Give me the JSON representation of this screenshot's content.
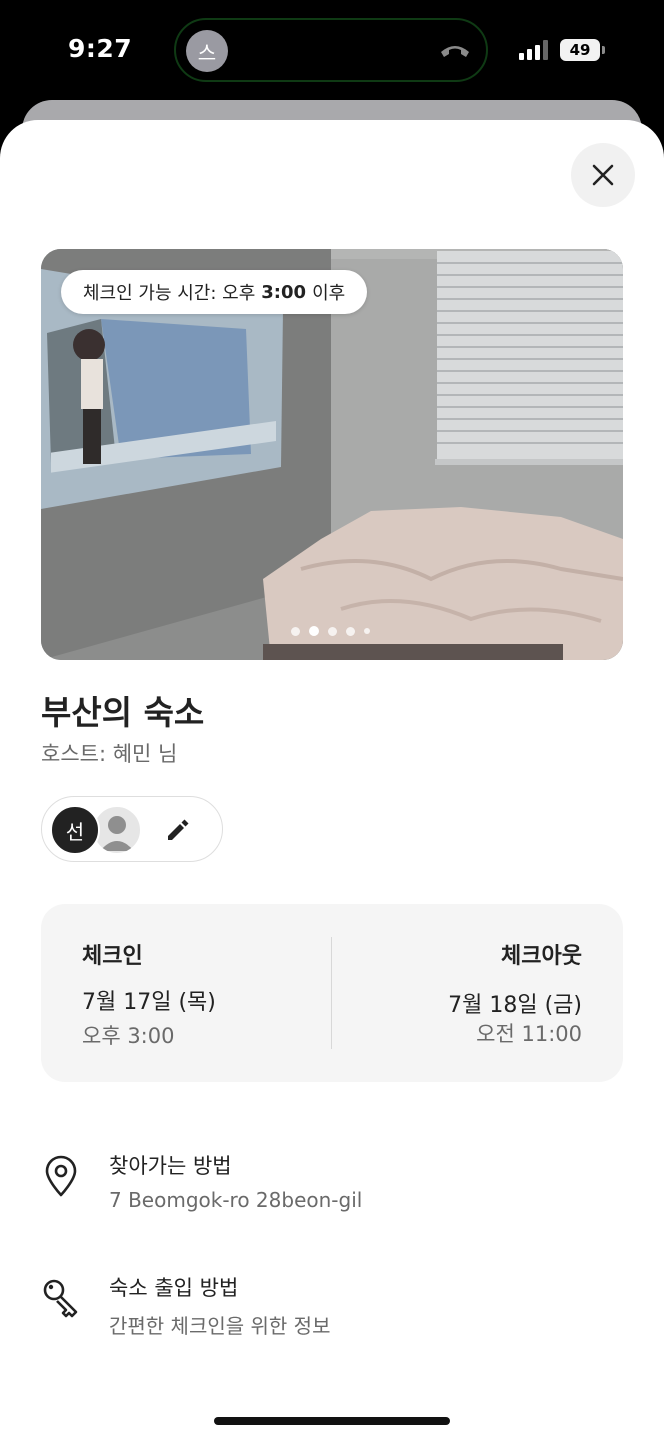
{
  "status_bar": {
    "time": "9:27",
    "island_avatar_initial": "스",
    "battery_level": "49"
  },
  "listing": {
    "checkin_badge_prefix": "체크인 가능 시간: 오후",
    "checkin_badge_time": "3:00",
    "checkin_badge_suffix": "이후",
    "photo_count": 5,
    "active_photo_index": 1,
    "title": "부산의 숙소",
    "host": "호스트: 혜민 님"
  },
  "guests": {
    "first_initial": "선"
  },
  "dates": {
    "checkin_label": "체크인",
    "checkin_date": "7월 17일 (목)",
    "checkin_time": "오후 3:00",
    "checkout_label": "체크아웃",
    "checkout_date": "7월 18일 (금)",
    "checkout_time": "오전 11:00"
  },
  "info_rows": [
    {
      "icon": "location-pin-icon",
      "title": "찾아가는 방법",
      "subtitle": "7 Beomgok-ro 28beon-gil"
    },
    {
      "icon": "key-icon",
      "title": "숙소 출입 방법",
      "subtitle": "간편한 체크인을 위한 정보"
    }
  ]
}
